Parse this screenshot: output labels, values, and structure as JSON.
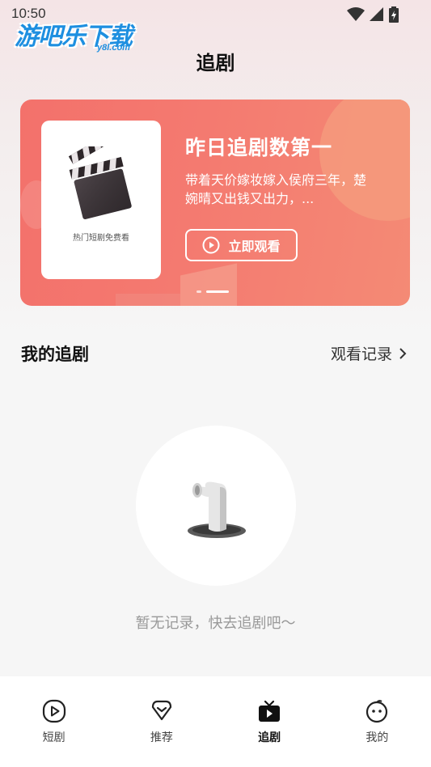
{
  "status_bar": {
    "time": "10:50"
  },
  "watermark": {
    "text": "游吧乐下载",
    "sub": "y8l.com"
  },
  "header": {
    "title": "追剧"
  },
  "banner": {
    "poster_caption": "热门短剧免费看",
    "title": "昨日追剧数第一",
    "description": "带着天价嫁妆嫁入侯府三年，楚婉晴又出钱又出力，...",
    "button_label": "立即观看"
  },
  "my_dramas": {
    "title": "我的追剧",
    "history_link": "观看记录",
    "empty_text": "暂无记录，快去追剧吧～"
  },
  "bottom_nav": {
    "items": [
      {
        "label": "短剧",
        "icon": "play-circle-icon"
      },
      {
        "label": "推荐",
        "icon": "heart-diamond-icon"
      },
      {
        "label": "追剧",
        "icon": "tv-icon",
        "active": true
      },
      {
        "label": "我的",
        "icon": "face-icon"
      }
    ]
  },
  "colors": {
    "banner": "#f3716b",
    "accent_text": "#111111",
    "muted_text": "#999999"
  }
}
